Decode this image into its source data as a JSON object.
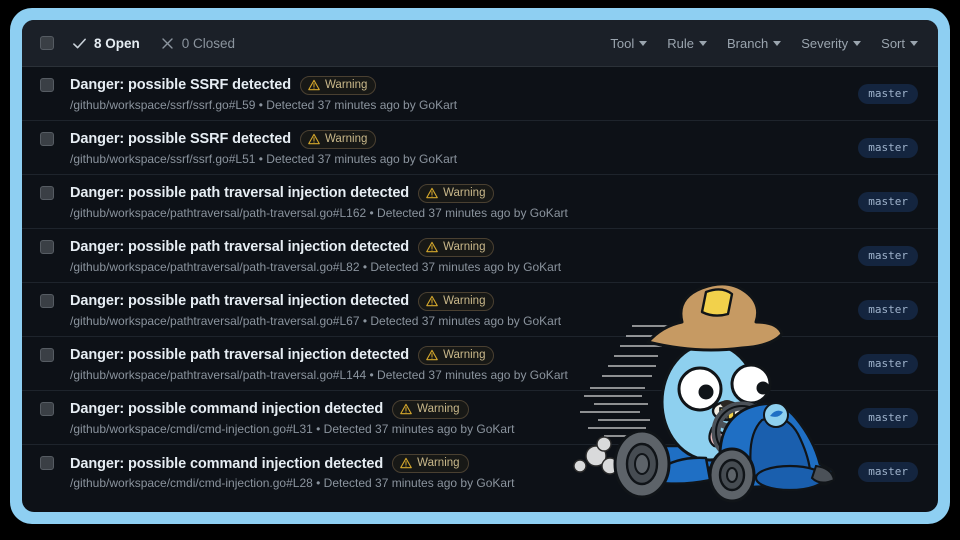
{
  "window": {
    "frame_color": "#8ecff2",
    "background": "#0d1117",
    "toolbar_background": "#1b2028"
  },
  "toolbar": {
    "select_all_checkbox": "",
    "open_count_label": "8 Open",
    "closed_count_label": "0 Closed",
    "open_icon": "check-icon",
    "closed_icon": "x-icon",
    "filters": [
      {
        "label": "Tool",
        "icon": "chevron-down-icon"
      },
      {
        "label": "Rule",
        "icon": "chevron-down-icon"
      },
      {
        "label": "Branch",
        "icon": "chevron-down-icon"
      },
      {
        "label": "Severity",
        "icon": "chevron-down-icon"
      },
      {
        "label": "Sort",
        "icon": "chevron-down-icon"
      }
    ]
  },
  "severity": {
    "label": "Warning",
    "icon": "warning-triangle-icon",
    "color": "#d4a72c"
  },
  "issues": [
    {
      "title": "Danger: possible SSRF detected",
      "severity": "Warning",
      "meta": "/github/workspace/ssrf/ssrf.go#L59 • Detected 37 minutes ago by GoKart",
      "branch": "master"
    },
    {
      "title": "Danger: possible SSRF detected",
      "severity": "Warning",
      "meta": "/github/workspace/ssrf/ssrf.go#L51 • Detected 37 minutes ago by GoKart",
      "branch": "master"
    },
    {
      "title": "Danger: possible path traversal injection detected",
      "severity": "Warning",
      "meta": "/github/workspace/pathtraversal/path-traversal.go#L162 • Detected 37 minutes ago by GoKart",
      "branch": "master"
    },
    {
      "title": "Danger: possible path traversal injection detected",
      "severity": "Warning",
      "meta": "/github/workspace/pathtraversal/path-traversal.go#L82 • Detected 37 minutes ago by GoKart",
      "branch": "master"
    },
    {
      "title": "Danger: possible path traversal injection detected",
      "severity": "Warning",
      "meta": "/github/workspace/pathtraversal/path-traversal.go#L67 • Detected 37 minutes ago by GoKart",
      "branch": "master"
    },
    {
      "title": "Danger: possible path traversal injection detected",
      "severity": "Warning",
      "meta": "/github/workspace/pathtraversal/path-traversal.go#L144 • Detected 37 minutes ago by GoKart",
      "branch": "master"
    },
    {
      "title": "Danger: possible command injection detected",
      "severity": "Warning",
      "meta": "/github/workspace/cmdi/cmd-injection.go#L31 • Detected 37 minutes ago by GoKart",
      "branch": "master"
    },
    {
      "title": "Danger: possible command injection detected",
      "severity": "Warning",
      "meta": "/github/workspace/cmdi/cmd-injection.go#L28 • Detected 37 minutes ago by GoKart",
      "branch": "master"
    }
  ],
  "mascot": {
    "name": "gokart-gopher-mascot",
    "description": "Go gopher in cowboy hat driving a blue go-kart"
  }
}
